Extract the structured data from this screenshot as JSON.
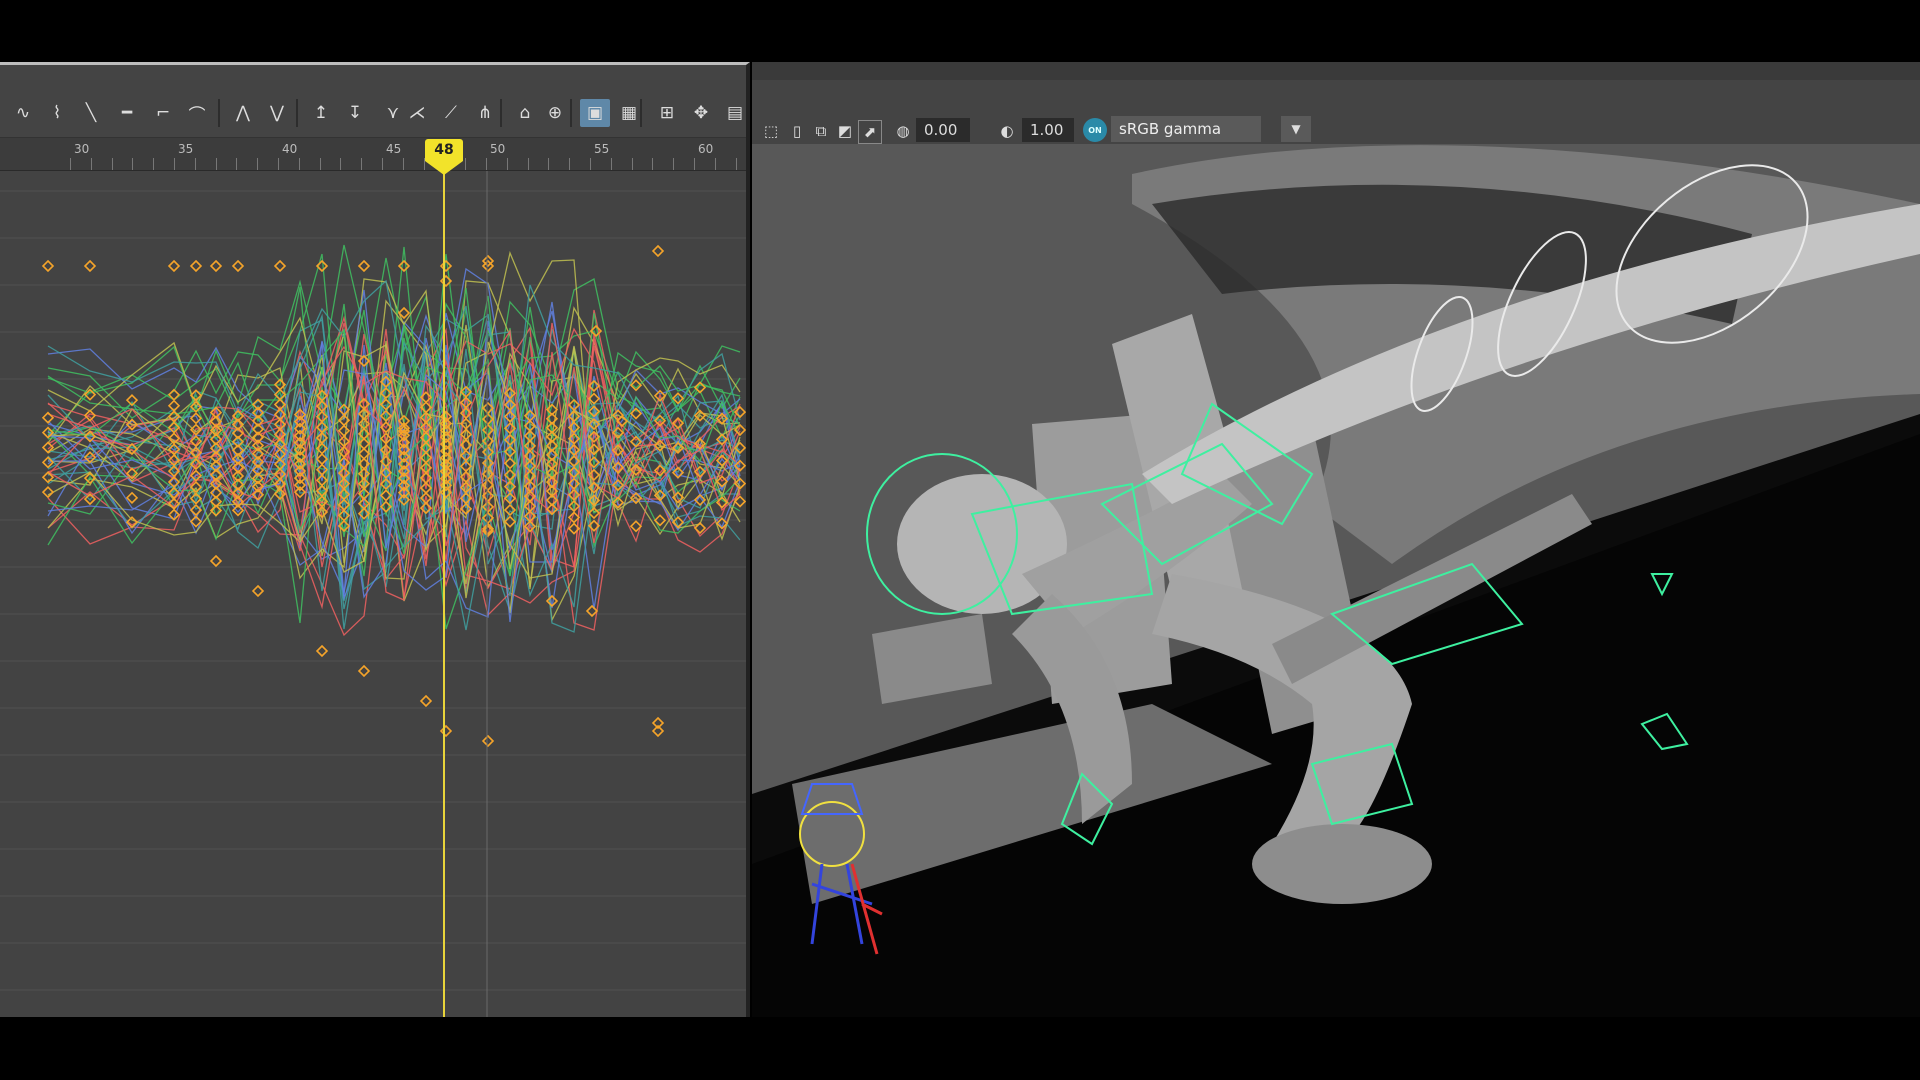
{
  "graph_editor": {
    "ruler_labels": [
      "30",
      "35",
      "40",
      "45",
      "50",
      "55",
      "60"
    ],
    "current_frame": "48",
    "toolbar_icons": [
      "spline-tangent-icon",
      "clamped-tangent-icon",
      "linear-tangent-icon",
      "flat-tangent-icon",
      "step-tangent-icon",
      "plateau-tangent-icon",
      "break-tangents-icon",
      "unify-tangents-icon",
      "free-tangent-weight-icon",
      "lock-tangent-weight-icon",
      "lattice-deform-icon",
      "tangent-sync-icon",
      "key-ticks-icon",
      "buffer-curve-icon",
      "auto-load-icon",
      "select-loaded-icon",
      "snap-icon",
      "magnet-icon",
      "move-keys-icon",
      "normalize-icon",
      "curve-presets-icon",
      "time-icon"
    ]
  },
  "viewport": {
    "exposure_value": "0.00",
    "gamma_value": "1.00",
    "color_management_badge": "ON",
    "colorspace_label": "sRGB gamma"
  },
  "colors": {
    "key_orange": "#f5a42a",
    "current_time_yellow": "#e8d43a",
    "rig_green": "#3ef0a0",
    "active_button_blue": "#5f88a8"
  }
}
